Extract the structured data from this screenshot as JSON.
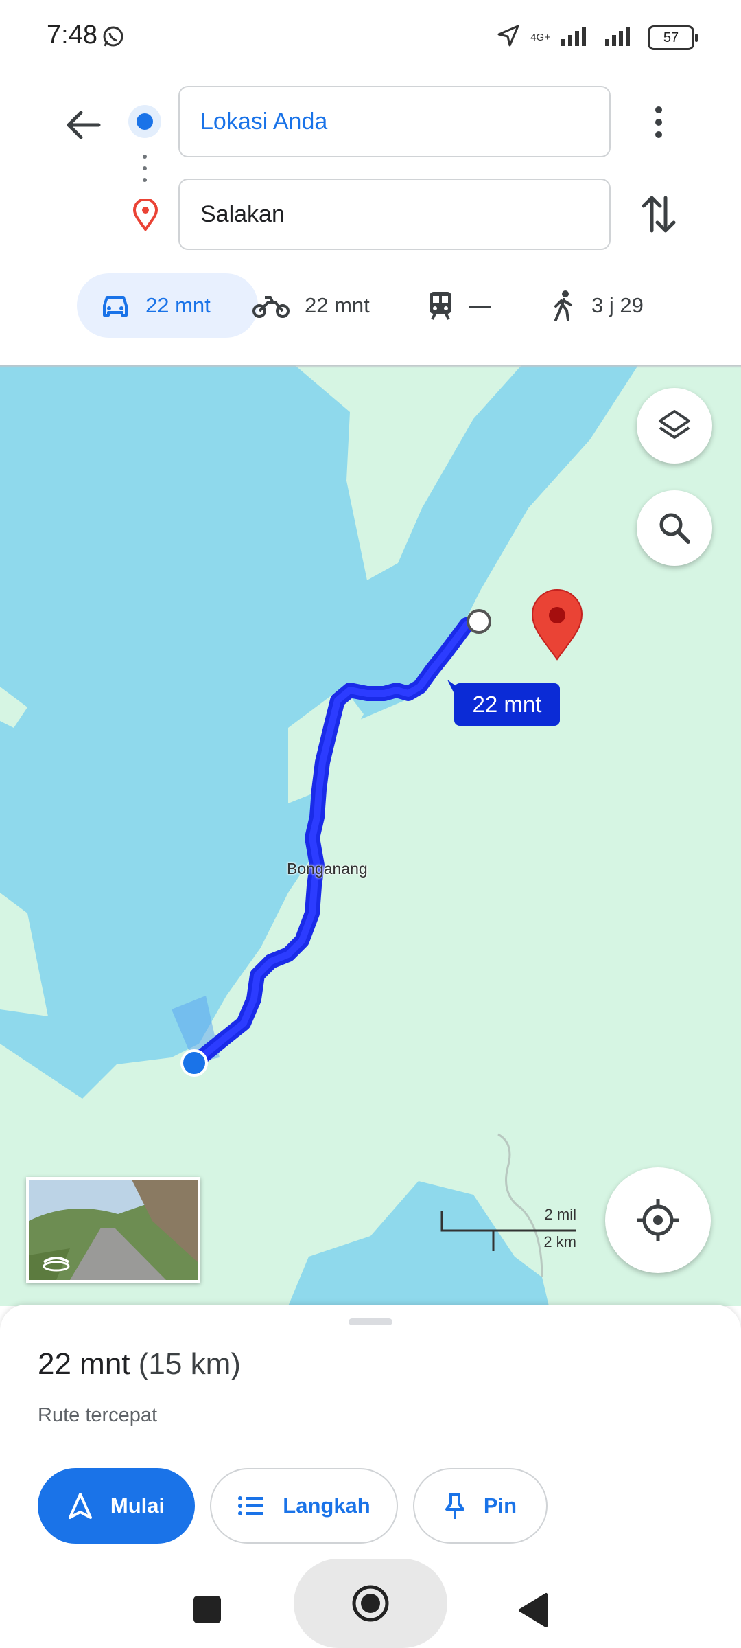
{
  "status": {
    "time": "7:48",
    "network": "4G+",
    "battery": "57"
  },
  "directions": {
    "origin": "Lokasi Anda",
    "destination": "Salakan"
  },
  "modes": [
    {
      "name": "car",
      "label": "22 mnt",
      "active": true
    },
    {
      "name": "motorcycle",
      "label": "22 mnt",
      "active": false
    },
    {
      "name": "transit",
      "label": "—",
      "active": false
    },
    {
      "name": "walk",
      "label": "3 j 29",
      "active": false
    }
  ],
  "map": {
    "route_eta": "22 mnt",
    "place_label": "Bonganang",
    "scale": {
      "miles": "2 mil",
      "km": "2 km"
    },
    "colors": {
      "water": "#8fd9ec",
      "land": "#d6f5e3",
      "route": "#1a2be8",
      "pin": "#ea4335"
    }
  },
  "sheet": {
    "duration": "22 mnt",
    "distance": "(15 km)",
    "subtitle": "Rute tercepat",
    "buttons": {
      "start": "Mulai",
      "steps": "Langkah",
      "pin": "Pin"
    }
  },
  "icons": [
    "whatsapp-icon",
    "location-arrow-icon",
    "signal-icon",
    "back-arrow-icon",
    "more-vert-icon",
    "swap-icon",
    "car-icon",
    "motorcycle-icon",
    "train-icon",
    "walk-icon",
    "layers-icon",
    "search-icon",
    "my-location-icon",
    "navigation-icon",
    "list-icon",
    "pin-icon"
  ]
}
